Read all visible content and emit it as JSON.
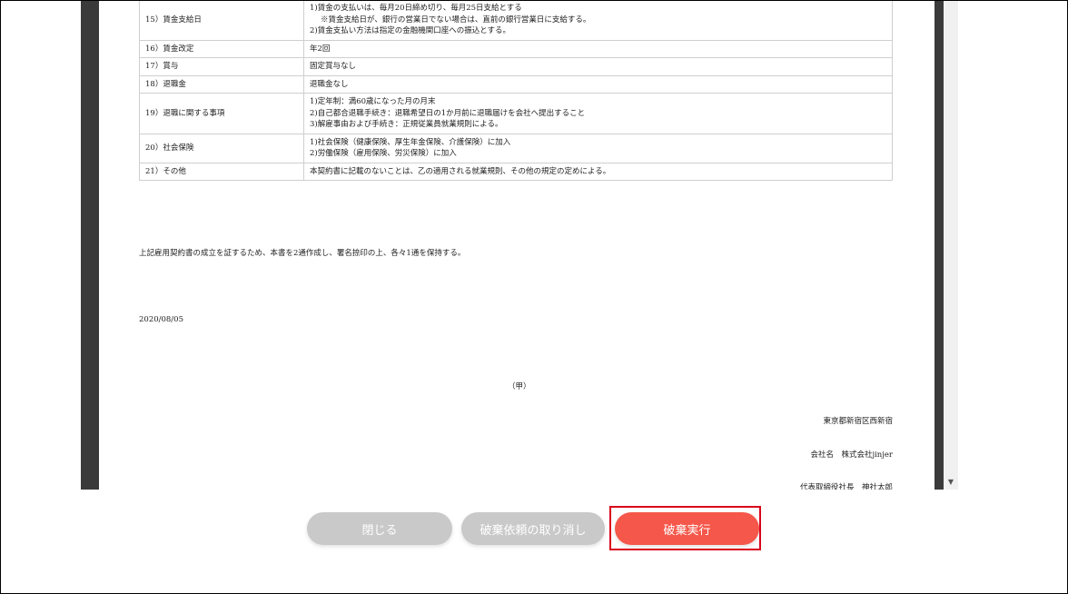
{
  "document": {
    "rows": [
      {
        "label": "15）賃金支給日",
        "lines": [
          "1)賃金の支払いは、毎月20日締め切り、毎月25日支給とする",
          "※賃金支給日が、銀行の営業日でない場合は、直前の銀行営業日に支給する。",
          "2)賃金支払い方法は指定の金融機関口座への振込とする。"
        ]
      },
      {
        "label": "16）賃金改定",
        "lines": [
          "年2回"
        ]
      },
      {
        "label": "17）賞与",
        "lines": [
          "固定賞与なし"
        ]
      },
      {
        "label": "18）退職金",
        "lines": [
          "退職金なし"
        ]
      },
      {
        "label": "19）退職に関する事項",
        "lines": [
          "1)定年制：満60歳になった月の月末",
          "2)自己都合退職手続き：退職希望日の1か月前に退職届けを会社へ提出すること",
          "3)解雇事由および手続き：正規従業員就業規則による。"
        ]
      },
      {
        "label": "20）社会保険",
        "lines": [
          "1)社会保険（健康保険、厚生年金保険、介護保険）に加入",
          "2)労働保険（雇用保険、労災保険）に加入"
        ]
      },
      {
        "label": "21）その他",
        "lines": [
          "本契約書に記載のないことは、乙の適用される就業規則、その他の規定の定めによる。"
        ]
      }
    ],
    "statement": "上記雇用契約書の成立を証するため、本書を2通作成し、署名捺印の上、各々1通を保持する。",
    "date": "2020/08/05",
    "party": "（甲）",
    "address": "東京都新宿区西新宿",
    "company": "会社名　株式会社jinjer",
    "representative": "代表取締役社長　神社太郎"
  },
  "buttons": {
    "close": "閉じる",
    "cancel_request": "破棄依頼の取り消し",
    "execute": "破棄実行"
  },
  "colors": {
    "execute_button": "#f5574a",
    "disabled_button": "#c9c9c9",
    "highlight_border": "#d9001b"
  }
}
